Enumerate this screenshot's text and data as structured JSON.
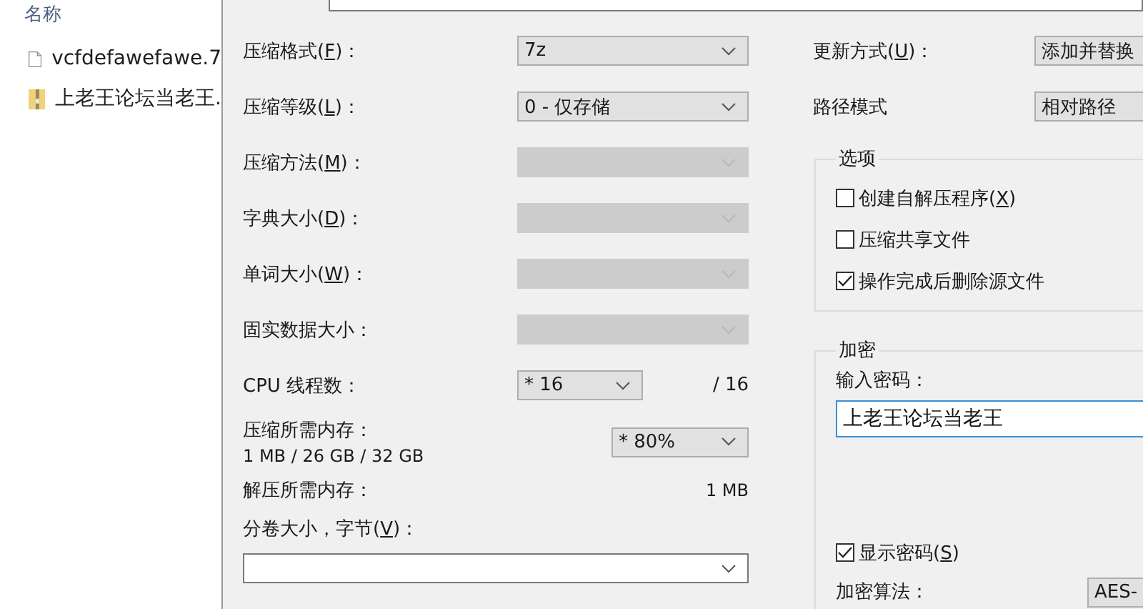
{
  "explorer": {
    "column_header": "名称",
    "files": [
      {
        "name": "vcfdefawefawe.7",
        "kind": "file"
      },
      {
        "name": "上老王论坛当老王.",
        "kind": "archive"
      }
    ]
  },
  "dialog": {
    "left_rows": [
      {
        "kind": "select",
        "label": {
          "before": "压缩格式(",
          "key": "F",
          "after": ")："
        },
        "value": "7z",
        "disabled": false
      },
      {
        "kind": "select",
        "label": {
          "before": "压缩等级(",
          "key": "L",
          "after": ")："
        },
        "value": "0 - 仅存储",
        "disabled": false
      },
      {
        "kind": "select",
        "label": {
          "before": "压缩方法(",
          "key": "M",
          "after": ")："
        },
        "disabled": true
      },
      {
        "kind": "select",
        "label": {
          "before": "字典大小(",
          "key": "D",
          "after": ")："
        },
        "disabled": true
      },
      {
        "kind": "select",
        "label": {
          "before": "单词大小(",
          "key": "W",
          "after": ")："
        },
        "disabled": true
      },
      {
        "kind": "select",
        "label": {
          "before": "固实数据大小："
        },
        "disabled": true
      },
      {
        "kind": "threads",
        "label": {
          "before": "CPU 线程数："
        },
        "value": "* 16",
        "suffix": "/ 16",
        "disabled": false
      },
      {
        "kind": "memory",
        "label": {
          "before": "压缩所需内存："
        },
        "detail": "1 MB / 26 GB / 32 GB",
        "value": "* 80%",
        "disabled": false
      },
      {
        "kind": "value",
        "label": {
          "before": "解压所需内存："
        },
        "value": "1 MB"
      },
      {
        "kind": "combo",
        "label": {
          "before": "分卷大小，字节(",
          "key": "V",
          "after": ")："
        }
      }
    ],
    "right_rows": [
      {
        "label": {
          "before": "更新方式(",
          "key": "U",
          "after": ")："
        },
        "value": "添加并替换"
      },
      {
        "label": {
          "before": "路径模式"
        },
        "value": "相对路径"
      }
    ],
    "options": {
      "title": "选项",
      "items": [
        {
          "label": {
            "before": "创建自解压程序(",
            "key": "X",
            "after": ")"
          },
          "checked": false
        },
        {
          "label": {
            "before": "压缩共享文件"
          },
          "checked": false
        },
        {
          "label": {
            "before": "操作完成后删除源文件"
          },
          "checked": true
        }
      ]
    },
    "encryption": {
      "title": "加密",
      "password_label": "输入密码：",
      "password": "上老王论坛当老王",
      "show_password": {
        "label": {
          "before": "显示密码(",
          "key": "S",
          "after": ")"
        },
        "checked": true
      },
      "method_label": "加密算法：",
      "method": "AES-"
    }
  }
}
